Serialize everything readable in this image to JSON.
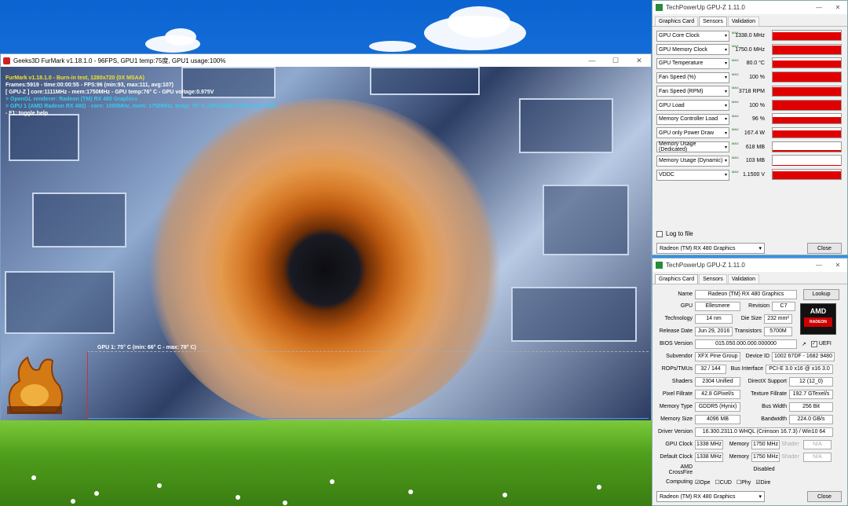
{
  "furmark": {
    "title": "Geeks3D FurMark v1.18.1.0 - 96FPS, GPU1 temp:75度, GPU1 usage:100%",
    "hud": [
      {
        "text": "FurMark v1.18.1.0 - Burn-in test, 1280x720 (0X MSAA)",
        "color": "#f3e22a"
      },
      {
        "text": "Frames:5919 - time:00:00:55 - FPS:96 (min:93, max:111, avg:107)",
        "color": "#ffffff"
      },
      {
        "text": "[ GPU-Z ] core:1111MHz - mem:1750MHz - GPU temp:76° C - GPU voltage:0.975V",
        "color": "#ffffff"
      },
      {
        "text": "> OpenGL renderer: Radeon (TM) RX 480 Graphics",
        "color": "#38c9f0"
      },
      {
        "text": "> GPU 1 (AMD Radeon RX 480) - core: 1085MHz, mem: 1750MHz, temp: 75° C, GPU load: 100%, fan: 89%",
        "color": "#38c9f0"
      },
      {
        "text": "- F1: toggle help",
        "color": "#ffffff"
      }
    ],
    "graph_caption": "GPU 1: 75° C (min: 66° C - max: 78° C)"
  },
  "gpuz_sensors": {
    "title": "TechPowerUp GPU-Z 1.11.0",
    "tabs": [
      "Graphics Card",
      "Sensors",
      "Validation"
    ],
    "active_tab": "Sensors",
    "sensors": [
      {
        "name": "GPU Core Clock",
        "value": "1338.0 MHz",
        "level": 0.85
      },
      {
        "name": "GPU Memory Clock",
        "value": "1750.0 MHz",
        "level": 0.9
      },
      {
        "name": "GPU Temperature",
        "value": "80.0 °C",
        "level": 0.8
      },
      {
        "name": "Fan Speed (%)",
        "value": "100 %",
        "level": 1.0
      },
      {
        "name": "Fan Speed (RPM)",
        "value": "3718 RPM",
        "level": 0.9
      },
      {
        "name": "GPU Load",
        "value": "100 %",
        "level": 0.95
      },
      {
        "name": "Memory Controller Load",
        "value": "96 %",
        "level": 0.7
      },
      {
        "name": "GPU only Power Draw",
        "value": "167.4 W",
        "level": 0.75
      },
      {
        "name": "Memory Usage (Dedicated)",
        "value": "618 MB",
        "level": 0.12
      },
      {
        "name": "Memory Usage (Dynamic)",
        "value": "103 MB",
        "level": 0.05
      },
      {
        "name": "VDDC",
        "value": "1.1500 V",
        "level": 0.8
      }
    ],
    "log_label": "Log to file",
    "device": "Radeon (TM) RX 480 Graphics",
    "close_label": "Close"
  },
  "gpuz_card": {
    "title": "TechPowerUp GPU-Z 1.11.0",
    "tabs": [
      "Graphics Card",
      "Sensors",
      "Validation"
    ],
    "name_label": "Name",
    "name": "Radeon (TM) RX 480 Graphics",
    "lookup": "Lookup",
    "gpu_label": "GPU",
    "gpu": "Ellesmere",
    "revision_label": "Revision",
    "revision": "C7",
    "tech_label": "Technology",
    "tech": "14 nm",
    "die_label": "Die Size",
    "die": "232 mm²",
    "release_label": "Release Date",
    "release": "Jun 29, 2016",
    "trans_label": "Transistors",
    "trans": "5700M",
    "bios_label": "BIOS Version",
    "bios": "015.050.000.000.000000",
    "uefi": "UEFI",
    "sub_label": "Subvendor",
    "sub": "XFX Pine Group",
    "devid_label": "Device ID",
    "devid": "1002 67DF - 1682 9480",
    "rops_label": "ROPs/TMUs",
    "rops": "32 / 144",
    "bus_label": "Bus Interface",
    "bus": "PCI-E 3.0 x16 @ x16 3.0",
    "shaders_label": "Shaders",
    "shaders": "2304 Unified",
    "dx_label": "DirectX Support",
    "dx": "12 (12_0)",
    "pix_label": "Pixel Fillrate",
    "pix": "42.8 GPixel/s",
    "tex_label": "Texture Fillrate",
    "tex": "192.7 GTexel/s",
    "memtype_label": "Memory Type",
    "memtype": "GDDR5 (Hynix)",
    "bw_label": "Bus Width",
    "bw": "256 Bit",
    "memsize_label": "Memory Size",
    "memsize": "4096 MB",
    "band_label": "Bandwidth",
    "band": "224.0 GB/s",
    "driver_label": "Driver Version",
    "driver": "16.300.2311.0 WHQL (Crimson 16.7.3) / Win10 64",
    "gpuclk_label": "GPU Clock",
    "gpuclk": "1338 MHz",
    "mem_label": "Memory",
    "memclk": "1750 MHz",
    "shader_label": "Shader",
    "na": "N/A",
    "defclk_label": "Default Clock",
    "defclk": "1338 MHz",
    "defmem": "1750 MHz",
    "cf_label": "AMD CrossFire",
    "cf": "Disabled",
    "comp_label": "Computing",
    "comp": [
      "Ope",
      "CUD",
      "Phy",
      "Dire"
    ],
    "amd_logo": "AMD",
    "amd_sub": "RADEON",
    "device": "Radeon (TM) RX 480 Graphics",
    "close_label": "Close"
  }
}
